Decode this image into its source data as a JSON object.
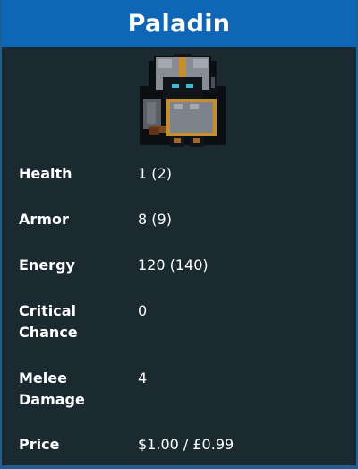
{
  "card": {
    "title": "Paladin",
    "sprite_icon": "paladin-knight-sprite",
    "header_color": "#0f65b6",
    "background_color": "#1b2a30",
    "stats": [
      {
        "label": "Health",
        "value": "1 (2)"
      },
      {
        "label": "Armor",
        "value": "8 (9)"
      },
      {
        "label": "Energy",
        "value": "120 (140)"
      },
      {
        "label": "Critical Chance",
        "value": "0"
      },
      {
        "label": "Melee Damage",
        "value": "4"
      },
      {
        "label": "Price",
        "value": "$1.00 / £0.99"
      }
    ]
  }
}
